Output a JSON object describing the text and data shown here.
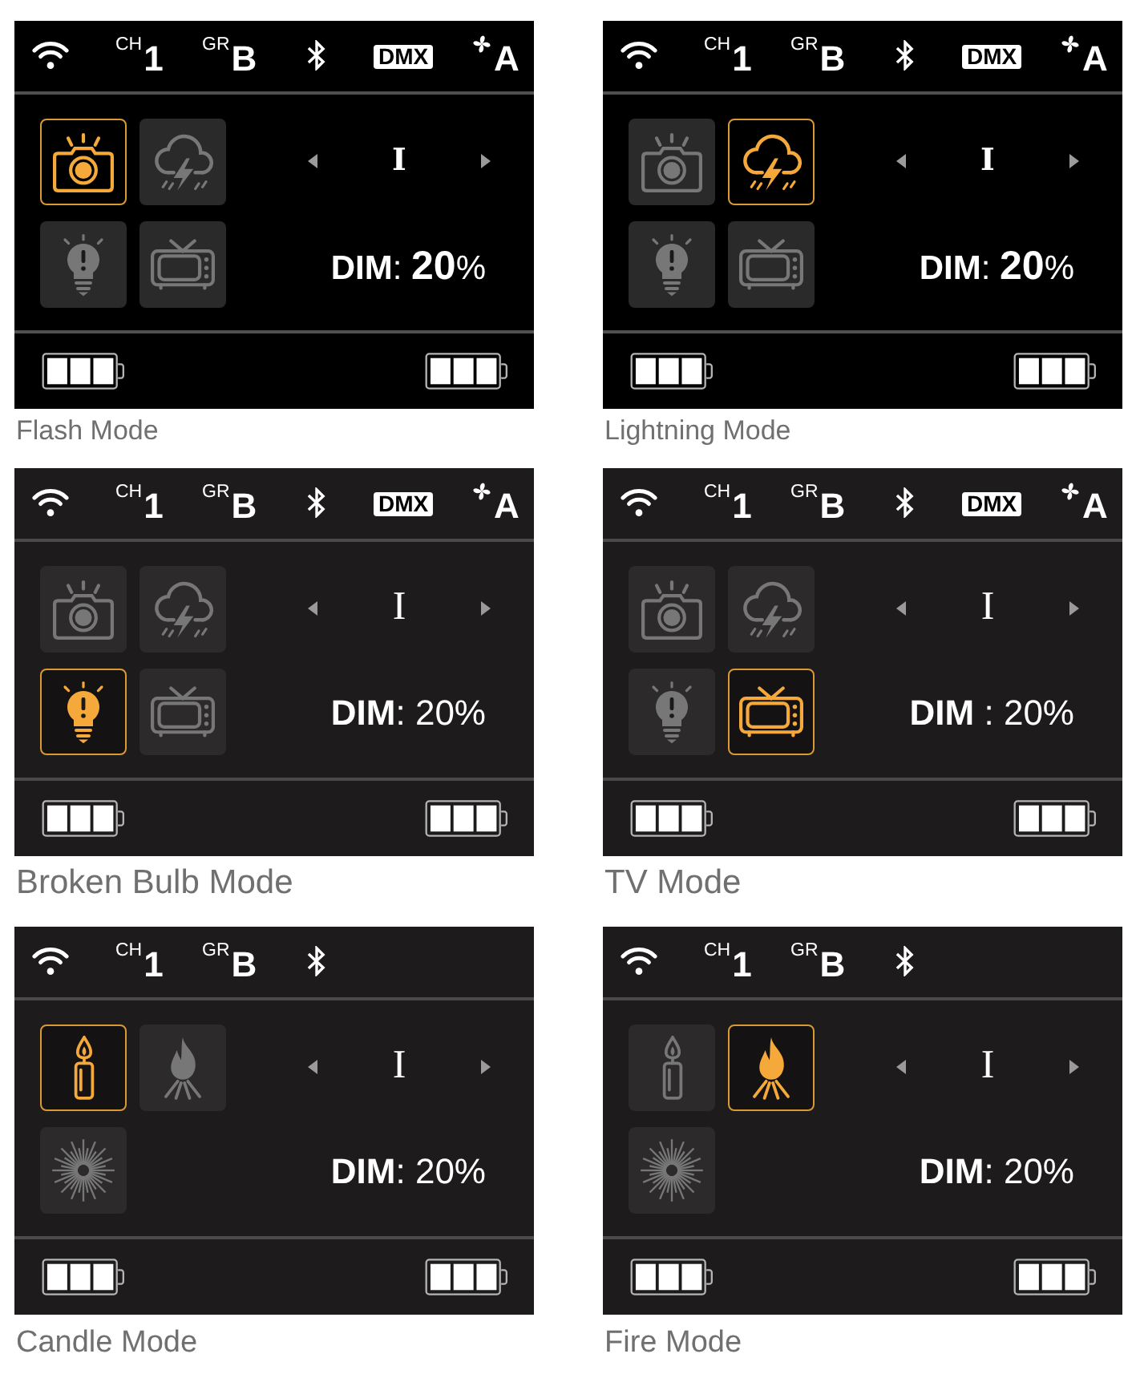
{
  "panels": [
    {
      "kind": "high-contrast",
      "status_bar": [
        {
          "kind": "wifi"
        },
        {
          "kind": "channel",
          "label": "CH",
          "value": "1"
        },
        {
          "kind": "group",
          "label": "GR",
          "value": "B"
        },
        {
          "kind": "bluetooth"
        },
        {
          "kind": "dmx",
          "text": "DMX"
        },
        {
          "kind": "fan",
          "value": "A"
        }
      ],
      "modes": [
        {
          "kind": "flash",
          "selected": true
        },
        {
          "kind": "lightning",
          "selected": false
        },
        {
          "kind": "broken-bulb",
          "selected": false
        },
        {
          "kind": "tv",
          "selected": false
        }
      ],
      "selector": {
        "value": "I"
      },
      "dim": "**DIM**: **20**%",
      "caption": "Flash Mode"
    },
    {
      "kind": "high-contrast",
      "status_bar": [
        {
          "kind": "wifi"
        },
        {
          "kind": "channel",
          "label": "CH",
          "value": "1"
        },
        {
          "kind": "group",
          "label": "GR",
          "value": "B"
        },
        {
          "kind": "bluetooth"
        },
        {
          "kind": "dmx",
          "text": "DMX"
        },
        {
          "kind": "fan",
          "value": "A"
        }
      ],
      "modes": [
        {
          "kind": "flash",
          "selected": false
        },
        {
          "kind": "lightning",
          "selected": true
        },
        {
          "kind": "broken-bulb",
          "selected": false
        },
        {
          "kind": "tv",
          "selected": false
        }
      ],
      "selector": {
        "value": "I"
      },
      "dim": "**DIM**: **20**%",
      "caption": "Lightning Mode"
    },
    {
      "kind": "standard",
      "status_bar": [
        {
          "kind": "wifi"
        },
        {
          "kind": "channel",
          "label": "CH",
          "value": "1"
        },
        {
          "kind": "group",
          "label": "GR",
          "value": "B"
        },
        {
          "kind": "bluetooth"
        },
        {
          "kind": "dmx",
          "text": "DMX"
        },
        {
          "kind": "fan",
          "value": "A"
        }
      ],
      "modes": [
        {
          "kind": "flash",
          "selected": false
        },
        {
          "kind": "lightning",
          "selected": false
        },
        {
          "kind": "broken-bulb",
          "selected": true
        },
        {
          "kind": "tv",
          "selected": false
        }
      ],
      "selector": {
        "value": "I"
      },
      "dim": "**DIM**: 20%",
      "caption": "Broken Bulb Mode"
    },
    {
      "kind": "standard",
      "status_bar": [
        {
          "kind": "wifi"
        },
        {
          "kind": "channel",
          "label": "CH",
          "value": "1"
        },
        {
          "kind": "group",
          "label": "GR",
          "value": "B"
        },
        {
          "kind": "bluetooth"
        },
        {
          "kind": "dmx",
          "text": "DMX"
        },
        {
          "kind": "fan",
          "value": "A"
        }
      ],
      "modes": [
        {
          "kind": "flash",
          "selected": false
        },
        {
          "kind": "lightning",
          "selected": false
        },
        {
          "kind": "broken-bulb",
          "selected": false
        },
        {
          "kind": "tv",
          "selected": true
        }
      ],
      "selector": {
        "value": "I"
      },
      "dim": "**DIM** : 20%",
      "caption": "TV Mode"
    },
    {
      "kind": "standard",
      "status_bar": [
        {
          "kind": "wifi"
        },
        {
          "kind": "channel",
          "label": "CH",
          "value": "1"
        },
        {
          "kind": "group",
          "label": "GR",
          "value": "B"
        },
        {
          "kind": "bluetooth"
        }
      ],
      "modes": [
        {
          "kind": "candle",
          "selected": true
        },
        {
          "kind": "fire",
          "selected": false
        },
        {
          "kind": "starburst",
          "selected": false
        }
      ],
      "selector": {
        "value": "I"
      },
      "dim": "**DIM**: 20%",
      "caption": "Candle Mode"
    },
    {
      "kind": "standard",
      "status_bar": [
        {
          "kind": "wifi"
        },
        {
          "kind": "channel",
          "label": "CH",
          "value": "1"
        },
        {
          "kind": "group",
          "label": "GR",
          "value": "B"
        },
        {
          "kind": "bluetooth"
        }
      ],
      "modes": [
        {
          "kind": "candle",
          "selected": false
        },
        {
          "kind": "fire",
          "selected": true
        },
        {
          "kind": "starburst",
          "selected": false
        }
      ],
      "selector": {
        "value": "I"
      },
      "dim": "**DIM**: 20%",
      "caption": "Fire Mode"
    }
  ]
}
